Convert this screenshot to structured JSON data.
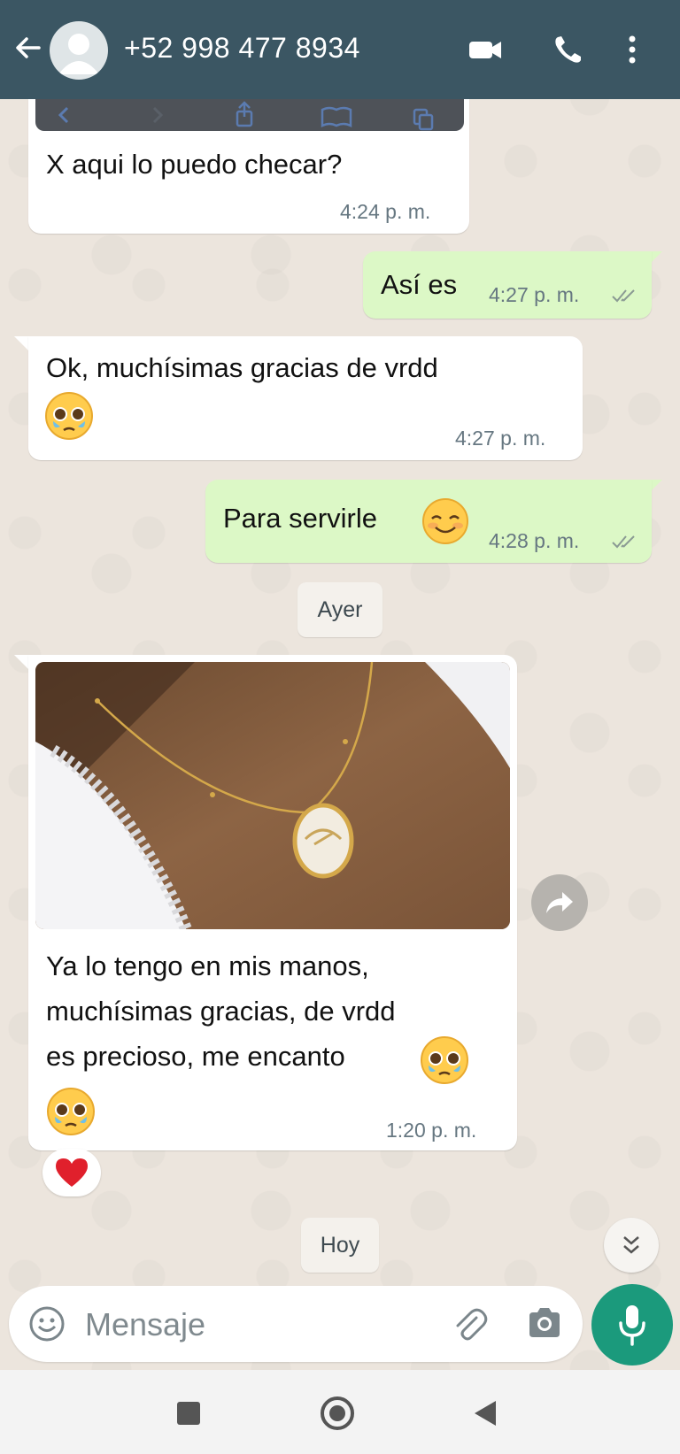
{
  "header": {
    "contact": "+52 998 477 8934",
    "icons": [
      "back-arrow-icon",
      "avatar",
      "video-call-icon",
      "phone-icon",
      "more-vert-icon"
    ],
    "color": "#3b5663"
  },
  "messages": [
    {
      "text": "X aqui lo puedo checar?",
      "time": "4:24 p. m.",
      "direction": "in"
    },
    {
      "text": "Así es",
      "time": "4:27 p. m.",
      "direction": "out",
      "status": "read"
    },
    {
      "text": "Ok, muchísimas gracias de vrdd",
      "emoji": "pleading-face",
      "time": "4:27 p. m.",
      "direction": "in"
    },
    {
      "text": "Para servirle",
      "emoji": "smiling-face",
      "time": "4:28 p. m.",
      "direction": "out",
      "status": "read"
    },
    {
      "lines": [
        "Ya lo tengo en mis manos,",
        "muchísimas gracias, de vrdd",
        "es precioso, me encanto"
      ],
      "emoji": "pleading-face",
      "time": "1:20 p. m.",
      "direction": "in",
      "has_photo": true,
      "reaction": "red-heart"
    }
  ],
  "dates": {
    "yesterday": "Ayer",
    "today": "Hoy"
  },
  "input": {
    "placeholder": "Mensaje"
  },
  "colors": {
    "outgoing": "#dcf8c6",
    "incoming": "#ffffff",
    "accent": "#1b9a7c"
  }
}
